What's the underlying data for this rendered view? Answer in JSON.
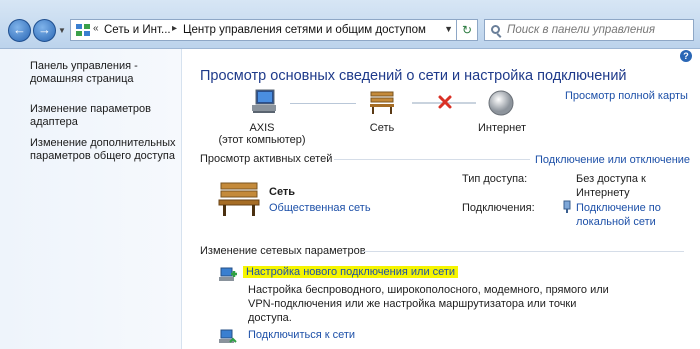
{
  "address_bar": {
    "crumbs": [
      "Сеть и Инт...",
      "Центр управления сетями и общим доступом"
    ],
    "search_placeholder": "Поиск в панели управления"
  },
  "left_pane": {
    "items": [
      {
        "label": "Панель управления - домашняя страница"
      },
      {
        "label": "Изменение параметров адаптера"
      },
      {
        "label": "Изменение дополнительных параметров общего доступа"
      }
    ]
  },
  "main": {
    "title": "Просмотр основных сведений о сети и настройка подключений",
    "full_map_link": "Просмотр полной карты",
    "map": {
      "computer_name": "AXIS",
      "computer_sub": "(этот компьютер)",
      "network_label": "Сеть",
      "internet_label": "Интернет"
    },
    "active_networks": {
      "header": "Просмотр активных сетей",
      "connect_link": "Подключение или отключение",
      "network_name": "Сеть",
      "network_type_link": "Общественная сеть",
      "access_type_label": "Тип доступа:",
      "access_type_value": "Без доступа к Интернету",
      "connections_label": "Подключения:",
      "connections_value": "Подключение по локальной сети"
    },
    "change_settings": {
      "header": "Изменение сетевых параметров",
      "items": [
        {
          "title": "Настройка нового подключения или сети",
          "description": "Настройка беспроводного, широкополосного, модемного, прямого или VPN-подключения или же настройка маршрутизатора или точки доступа."
        },
        {
          "title": "Подключиться к сети",
          "description": ""
        }
      ]
    }
  },
  "colors": {
    "link": "#1d50a8",
    "title": "#1e3a8a",
    "highlight": "#f5f500",
    "error_x": "#d93025"
  }
}
